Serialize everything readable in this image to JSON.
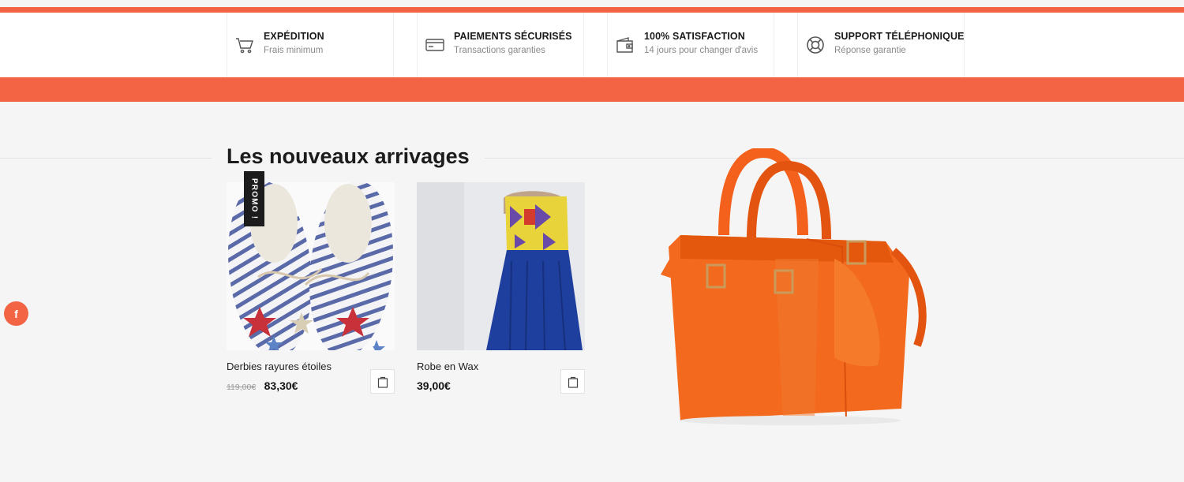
{
  "colors": {
    "accent": "#f26444",
    "background": "#f5f5f5",
    "text": "#1c1c1c",
    "muted": "#8a8a8a"
  },
  "features": [
    {
      "icon": "cart-icon",
      "title": "EXPÉDITION",
      "subtitle": "Frais minimum"
    },
    {
      "icon": "credit-card-icon",
      "title": "PAIEMENTS SÉCURISÉS",
      "subtitle": "Transactions garanties"
    },
    {
      "icon": "wallet-icon",
      "title": "100% SATISFACTION",
      "subtitle": "14 jours pour changer d'avis"
    },
    {
      "icon": "lifebuoy-icon",
      "title": "SUPPORT TÉLÉPHONIQUE",
      "subtitle": "Réponse garantie"
    }
  ],
  "section": {
    "title": "Les nouveaux arrivages"
  },
  "products": [
    {
      "name": "Derbies rayures étoiles",
      "old_price": "119,00€",
      "price": "83,30€",
      "badge": "PROMO !",
      "cart_icon": "shopping-bag-icon"
    },
    {
      "name": "Robe en Wax",
      "price": "39,00€",
      "cart_icon": "shopping-bag-icon"
    }
  ],
  "social": {
    "facebook_label": "f"
  },
  "promo_banner": {
    "image": "orange-handbag"
  }
}
